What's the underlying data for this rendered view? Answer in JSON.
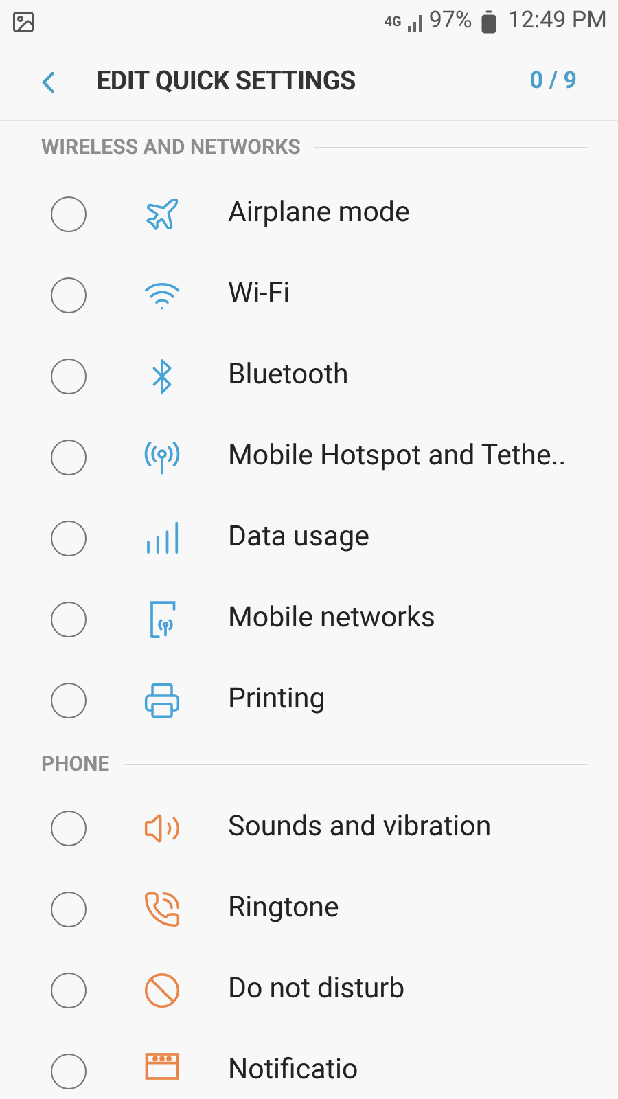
{
  "status_bar": {
    "network": "4G",
    "battery": "97%",
    "time": "12:49 PM"
  },
  "header": {
    "title": "EDIT QUICK SETTINGS",
    "counter": "0 / 9"
  },
  "sections": [
    {
      "title": "WIRELESS AND NETWORKS",
      "items": [
        {
          "label": "Airplane mode",
          "checked": false
        },
        {
          "label": "Wi-Fi",
          "checked": false
        },
        {
          "label": "Bluetooth",
          "checked": false
        },
        {
          "label": "Mobile Hotspot and Tethe..",
          "checked": false
        },
        {
          "label": "Data usage",
          "checked": false
        },
        {
          "label": "Mobile networks",
          "checked": false
        },
        {
          "label": "Printing",
          "checked": false
        }
      ]
    },
    {
      "title": "PHONE",
      "items": [
        {
          "label": "Sounds and vibration",
          "checked": false
        },
        {
          "label": "Ringtone",
          "checked": false
        },
        {
          "label": "Do not disturb",
          "checked": false
        },
        {
          "label": "Notificatio",
          "checked": false
        }
      ]
    }
  ]
}
